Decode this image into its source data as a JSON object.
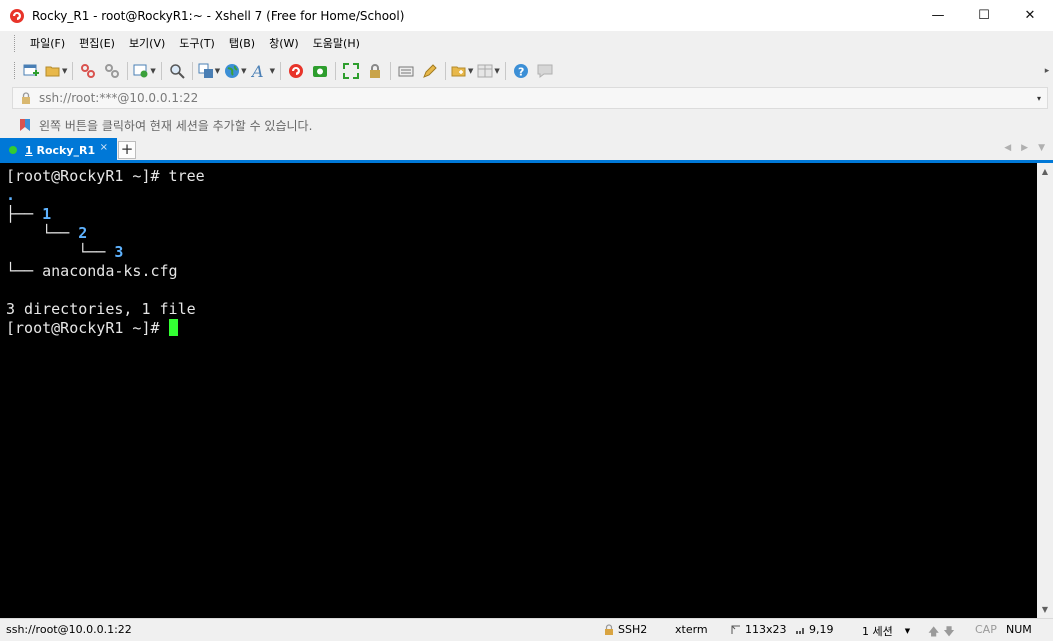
{
  "window": {
    "title": "Rocky_R1 - root@RockyR1:~ - Xshell 7 (Free for Home/School)",
    "minimize_glyph": "—",
    "maximize_glyph": "☐",
    "close_glyph": "✕"
  },
  "menu": [
    {
      "label": "파일(F)"
    },
    {
      "label": "편집(E)"
    },
    {
      "label": "보기(V)"
    },
    {
      "label": "도구(T)"
    },
    {
      "label": "탭(B)"
    },
    {
      "label": "창(W)"
    },
    {
      "label": "도움말(H)"
    }
  ],
  "address": {
    "value": "ssh://root:***@10.0.0.1:22",
    "dropdown_glyph": "▾"
  },
  "info": {
    "text": "왼쪽 버튼을 클릭하여 현재 세션을 추가할 수 있습니다."
  },
  "tabs": [
    {
      "number": "1",
      "label": " Rocky_R1",
      "close_glyph": "×"
    }
  ],
  "tab_add_glyph": "+",
  "terminal": {
    "prompt1": "[root@RockyR1 ~]# tree",
    "tree_root": ".",
    "tree_l1_prefix": "├── ",
    "dir1": "1",
    "tree_l2_prefix": "    └── ",
    "dir2": "2",
    "tree_l3_prefix": "        └── ",
    "dir3": "3",
    "tree_l4_prefix": "└── ",
    "file1": "anaconda-ks.cfg",
    "summary": "3 directories, 1 file",
    "prompt2": "[root@RockyR1 ~]# "
  },
  "status": {
    "connection": "ssh://root@10.0.0.1:22",
    "protocol": "SSH2",
    "terminal_type": "xterm",
    "size": "113x23",
    "cursor_pos": "9,19",
    "sessions": "1 세션",
    "caps": "CAP",
    "num": "NUM"
  },
  "colors": {
    "accent": "#0078d7",
    "terminal_bg": "#000000",
    "terminal_fg": "#e6e6e6",
    "directory": "#5fb3ff",
    "cursor": "#33ff33"
  }
}
